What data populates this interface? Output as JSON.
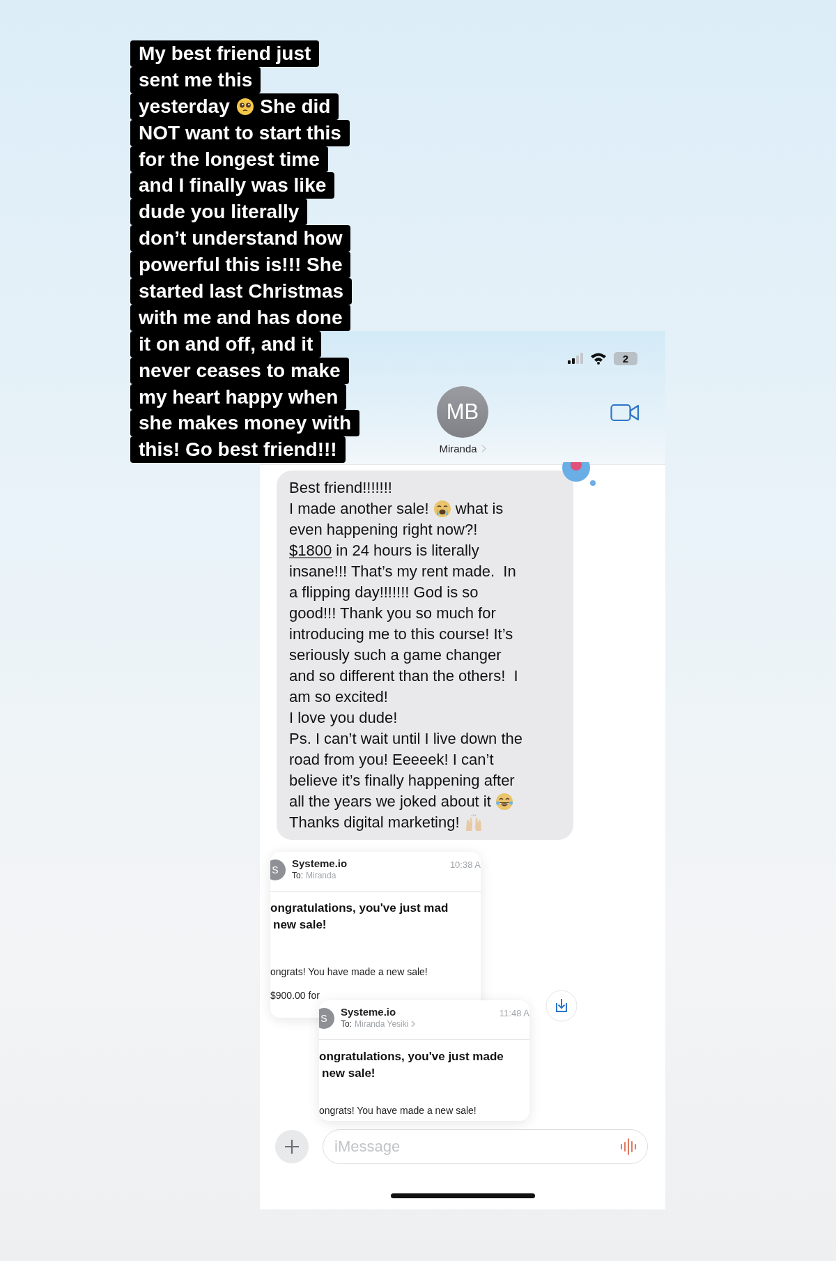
{
  "story_caption": {
    "lines": [
      [
        {
          "text": "My best friend just"
        }
      ],
      [
        {
          "text": "sent me this"
        }
      ],
      [
        {
          "text": "yesterday "
        },
        {
          "kind": "emoji"
        },
        {
          "text": " She did"
        }
      ],
      [
        {
          "text": "NOT want to start this"
        }
      ],
      [
        {
          "text": "for the longest time"
        }
      ],
      [
        {
          "text": "and I finally was like"
        }
      ],
      [
        {
          "text": "dude you literally"
        }
      ],
      [
        {
          "text": "don’t understand how"
        }
      ],
      [
        {
          "text": "powerful this is!!! She"
        }
      ],
      [
        {
          "text": "started last Christmas"
        }
      ],
      [
        {
          "text": "with me and has done"
        }
      ],
      [
        {
          "text": "it on and off, and it"
        }
      ],
      [
        {
          "text": "never ceases to make"
        }
      ],
      [
        {
          "text": "my heart happy when"
        }
      ],
      [
        {
          "text": "she makes money with"
        }
      ],
      [
        {
          "text": "this! Go best friend!!!"
        }
      ]
    ]
  },
  "phone": {
    "status_bar": {
      "battery": "2"
    },
    "contact": {
      "initials": "MB",
      "name": "Miranda"
    },
    "message": {
      "has_reaction": true,
      "lines": [
        [
          {
            "text": "Best friend!!!!!!!"
          }
        ],
        [
          {
            "text": "I made another sale! "
          },
          {
            "kind": "emoji"
          },
          {
            "text": " what is"
          }
        ],
        [
          {
            "text": "even happening right now?!"
          }
        ],
        [
          {
            "text": "$1800",
            "underline": true
          },
          {
            "text": " in 24 hours is literally"
          }
        ],
        [
          {
            "text": "insane!!! That’s my rent made.  In"
          }
        ],
        [
          {
            "text": "a flipping day!!!!!!! God is so"
          }
        ],
        [
          {
            "text": "good!!! Thank you so much for"
          }
        ],
        [
          {
            "text": "introducing me to this course! It’s"
          }
        ],
        [
          {
            "text": "seriously such a game changer"
          }
        ],
        [
          {
            "text": "and so different than the others!  I"
          }
        ],
        [
          {
            "text": "am so excited!"
          }
        ],
        [
          {
            "text": "I love you dude!"
          }
        ],
        [
          {
            "text": "Ps. I can’t wait until I live down the"
          }
        ],
        [
          {
            "text": "road from you! Eeeeek! I can’t"
          }
        ],
        [
          {
            "text": "believe it’s finally happening after"
          }
        ],
        [
          {
            "text": "all the years we joked about it "
          },
          {
            "kind": "emoji"
          }
        ],
        [
          {
            "text": "Thanks digital marketing! "
          },
          {
            "kind": "emoji"
          }
        ]
      ]
    },
    "emails": [
      {
        "avatar": "S",
        "sender": "Systeme.io",
        "to_label": "To:",
        "recipient": "Miranda",
        "chevron": false,
        "time": "10:38 A",
        "subject_lines": [
          "ongratulations, you've just mad",
          "new sale!"
        ],
        "body_lines": [
          "ongrats! You have made a new sale!",
          "$900.00 for"
        ]
      },
      {
        "avatar": "S",
        "sender": "Systeme.io",
        "to_label": "To:",
        "recipient": "Miranda Yesiki",
        "chevron": true,
        "time": "11:48 A",
        "subject_lines": [
          "ongratulations, you've just made",
          "new sale!"
        ],
        "body_lines": [
          "ongrats! You have made a new sale!"
        ]
      }
    ],
    "composer": {
      "placeholder": "iMessage"
    }
  }
}
